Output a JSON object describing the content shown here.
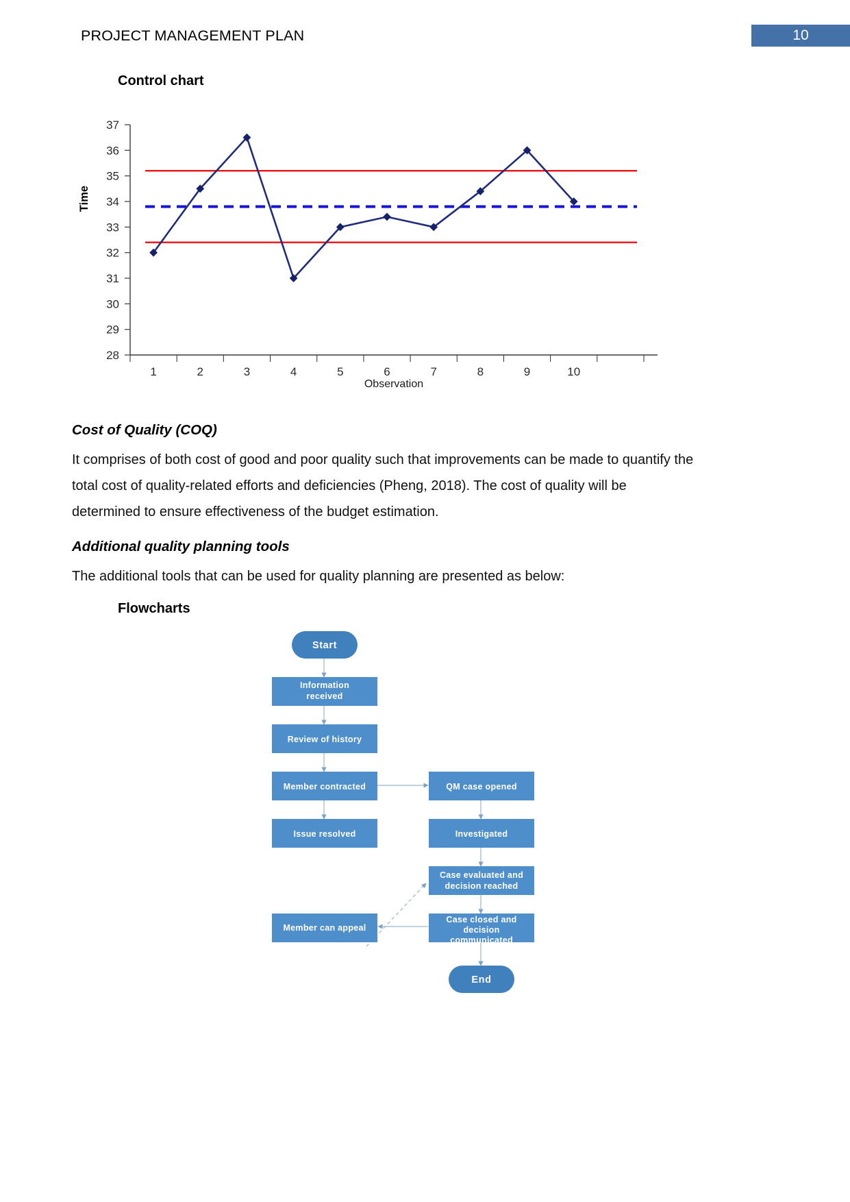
{
  "header": {
    "title": "PROJECT MANAGEMENT PLAN",
    "page_number": "10",
    "page_number_bg": "#4472a8"
  },
  "sections": {
    "control_chart_heading": "Control chart",
    "coq_heading": "Cost of Quality (COQ)",
    "coq_paragraph": "It comprises of both cost of good and poor quality such that improvements can be made to quantify the total cost of quality-related efforts and deficiencies (Pheng, 2018). The cost of quality will be determined to ensure effectiveness of the budget estimation.",
    "additional_tools_heading": "Additional quality planning tools",
    "additional_tools_paragraph": "The additional tools that can be used for quality planning are presented as below:",
    "flowcharts_heading": "Flowcharts"
  },
  "chart_data": {
    "type": "line",
    "title": "Control chart",
    "xlabel": "Observation",
    "ylabel": "Time",
    "x": [
      1,
      2,
      3,
      4,
      5,
      6,
      7,
      8,
      9,
      10
    ],
    "categories": [
      "1",
      "2",
      "3",
      "4",
      "5",
      "6",
      "7",
      "8",
      "9",
      "10"
    ],
    "ytick_labels": [
      "28",
      "29",
      "30",
      "31",
      "32",
      "33",
      "34",
      "35",
      "36",
      "37"
    ],
    "ylim": [
      28,
      37
    ],
    "xlim": [
      0.5,
      11.5
    ],
    "grid": false,
    "legend": "none",
    "series": [
      {
        "name": "Time",
        "values": [
          32,
          34.5,
          36.5,
          31,
          33,
          33.4,
          33,
          34.4,
          36,
          34
        ],
        "color": "#1f2d7a",
        "marker": "diamond",
        "marker_color": "#16226b"
      }
    ],
    "reference_lines": [
      {
        "name": "upper-control-limit",
        "value": 35.2,
        "color": "#ee1111",
        "style": "solid"
      },
      {
        "name": "center-line",
        "value": 33.8,
        "color": "#1414dd",
        "style": "dashed"
      },
      {
        "name": "lower-control-limit",
        "value": 32.4,
        "color": "#ee1111",
        "style": "solid"
      }
    ]
  },
  "flowchart": {
    "box_fill": "#4e8fcb",
    "terminator_fill": "#4080bd",
    "connector_color": "#9bb6cf",
    "nodes": [
      {
        "id": "start",
        "label": "Start",
        "shape": "terminator"
      },
      {
        "id": "information-received",
        "label": "Information\nreceived",
        "shape": "process"
      },
      {
        "id": "review-of-history",
        "label": "Review of history",
        "shape": "process"
      },
      {
        "id": "member-contracted",
        "label": "Member contracted",
        "shape": "process"
      },
      {
        "id": "qm-case-opened",
        "label": "QM case opened",
        "shape": "process"
      },
      {
        "id": "issue-resolved",
        "label": "Issue resolved",
        "shape": "process"
      },
      {
        "id": "investigated",
        "label": "Investigated",
        "shape": "process"
      },
      {
        "id": "case-evaluated",
        "label": "Case evaluated and\ndecision reached",
        "shape": "process"
      },
      {
        "id": "member-can-appeal",
        "label": "Member can appeal",
        "shape": "process"
      },
      {
        "id": "case-closed",
        "label": "Case closed and\ndecision\ncommunicated",
        "shape": "process"
      },
      {
        "id": "end",
        "label": "End",
        "shape": "terminator"
      }
    ],
    "labels": {
      "start": "Start",
      "information_received_line1": "Information",
      "information_received_line2": "received",
      "review_of_history": "Review of history",
      "member_contracted": "Member contracted",
      "qm_case_opened": "QM case opened",
      "issue_resolved": "Issue resolved",
      "investigated": "Investigated",
      "case_evaluated_line1": "Case evaluated and",
      "case_evaluated_line2": "decision reached",
      "member_can_appeal": "Member can appeal",
      "case_closed_line1": "Case closed and",
      "case_closed_line2": "decision",
      "case_closed_line3": "communicated",
      "end": "End"
    }
  }
}
